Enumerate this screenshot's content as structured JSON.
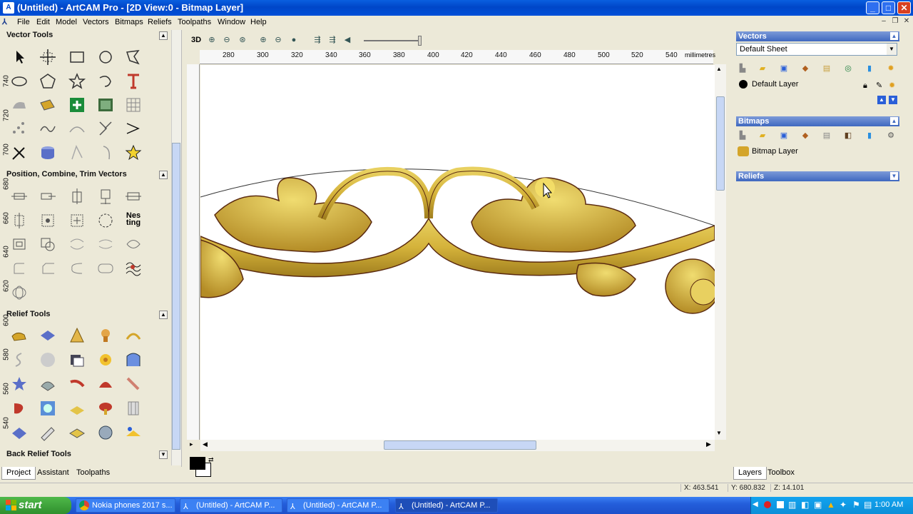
{
  "window": {
    "title": "(Untitled) - ArtCAM Pro - [2D View:0 - Bitmap Layer]",
    "min": "_",
    "max": "□",
    "close": "✕"
  },
  "menu": [
    "File",
    "Edit",
    "Model",
    "Vectors",
    "Bitmaps",
    "Reliefs",
    "Toolpaths",
    "Window",
    "Help"
  ],
  "left_panel": {
    "vector_tools": "Vector Tools",
    "position_tools": "Position, Combine, Trim Vectors",
    "relief_tools": "Relief Tools",
    "back_relief_tools": "Back Relief Tools",
    "nesting_label": "Nes ting"
  },
  "bottom_tabs": [
    "Project",
    "Assistant",
    "Toolpaths"
  ],
  "view_toolbar": {
    "mode_3d": "3D"
  },
  "ruler": {
    "h_ticks": [
      "280",
      "300",
      "320",
      "340",
      "360",
      "380",
      "400",
      "420",
      "440",
      "460",
      "480",
      "500",
      "520",
      "540"
    ],
    "unit": "millimetres",
    "v_ticks": [
      "740",
      "720",
      "700",
      "680",
      "660",
      "640",
      "620",
      "600",
      "580",
      "560",
      "540"
    ]
  },
  "right_panel": {
    "vectors_title": "Vectors",
    "sheet": "Default Sheet",
    "vector_layer": "Default Layer",
    "bitmaps_title": "Bitmaps",
    "bitmap_layer": "Bitmap Layer",
    "reliefs_title": "Reliefs",
    "tabs": [
      "Layers",
      "Toolbox"
    ]
  },
  "status": {
    "x": "X: 463.541",
    "y": "Y: 680.832",
    "z": "Z: 14.101"
  },
  "taskbar": {
    "start": "start",
    "tasks": [
      "Nokia phones 2017 s...",
      "(Untitled) - ArtCAM P...",
      "(Untitled) - ArtCAM P...",
      "(Untitled) - ArtCAM P..."
    ],
    "clock": "1:00 AM"
  },
  "colors": {
    "accent": "#0046c8",
    "gold": "#d4b23a",
    "panel": "#ece9d8"
  }
}
